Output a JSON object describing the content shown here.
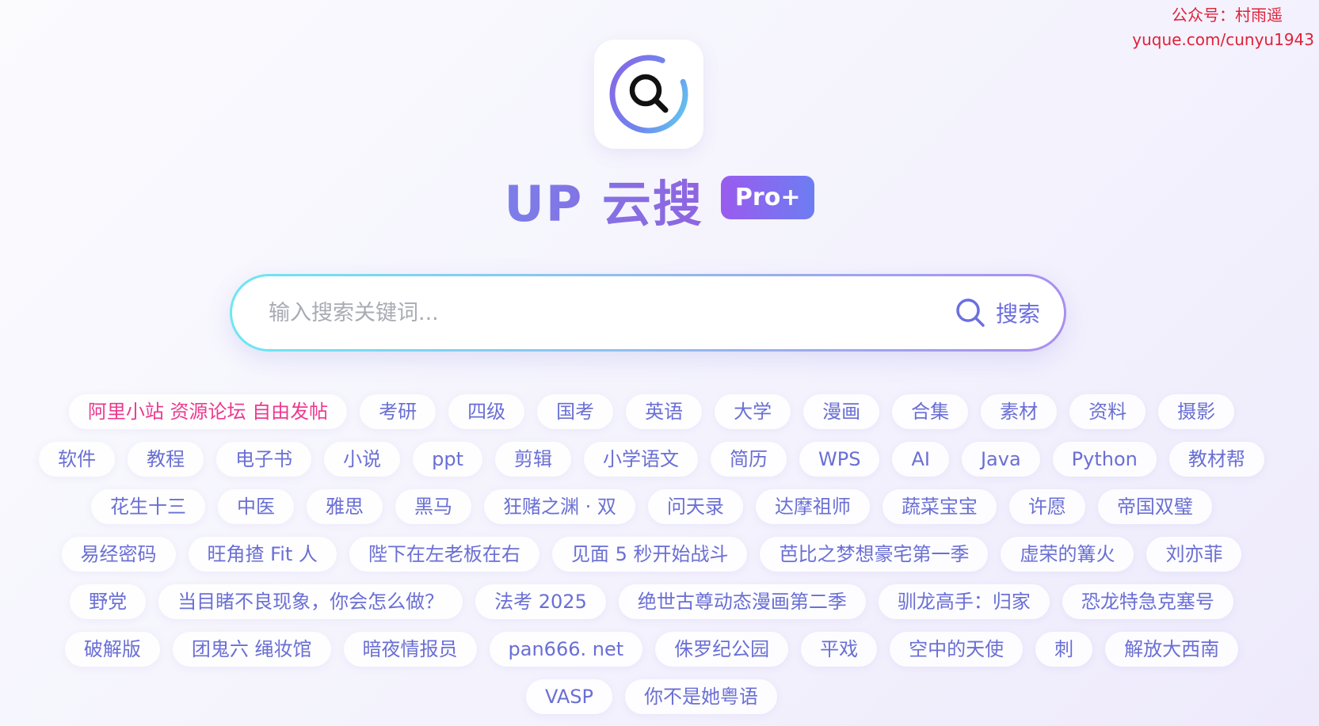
{
  "watermark": {
    "line1": "公众号：村雨遥",
    "line2": "yuque.com/cunyu1943"
  },
  "brand": {
    "title": "UP 云搜",
    "badge": "Pro+",
    "logo_icon": "search-logo-icon"
  },
  "search": {
    "placeholder": "输入搜索关键词...",
    "value": "",
    "button_label": "搜索",
    "button_icon": "search-icon"
  },
  "colors": {
    "accent": "#6c6ee0",
    "hot_tag": "#ec3a8e",
    "watermark": "#e0213a"
  },
  "tags": [
    {
      "label": "阿里小站 资源论坛 自由发帖",
      "hot": true
    },
    {
      "label": "考研"
    },
    {
      "label": "四级"
    },
    {
      "label": "国考"
    },
    {
      "label": "英语"
    },
    {
      "label": "大学"
    },
    {
      "label": "漫画"
    },
    {
      "label": "合集"
    },
    {
      "label": "素材"
    },
    {
      "label": "资料"
    },
    {
      "label": "摄影"
    },
    {
      "label": "软件"
    },
    {
      "label": "教程"
    },
    {
      "label": "电子书"
    },
    {
      "label": "小说"
    },
    {
      "label": "ppt"
    },
    {
      "label": "剪辑"
    },
    {
      "label": "小学语文"
    },
    {
      "label": "简历"
    },
    {
      "label": "WPS"
    },
    {
      "label": "AI"
    },
    {
      "label": "Java"
    },
    {
      "label": "Python"
    },
    {
      "label": "教材帮"
    },
    {
      "label": "花生十三"
    },
    {
      "label": "中医"
    },
    {
      "label": "雅思"
    },
    {
      "label": "黑马"
    },
    {
      "label": "狂赌之渊 · 双"
    },
    {
      "label": "问天录"
    },
    {
      "label": "达摩祖师"
    },
    {
      "label": "蔬菜宝宝"
    },
    {
      "label": "许愿"
    },
    {
      "label": "帝国双璧"
    },
    {
      "label": "易经密码"
    },
    {
      "label": "旺角揸 Fit 人"
    },
    {
      "label": "陛下在左老板在右"
    },
    {
      "label": "见面 5 秒开始战斗"
    },
    {
      "label": "芭比之梦想豪宅第一季"
    },
    {
      "label": "虚荣的篝火"
    },
    {
      "label": "刘亦菲"
    },
    {
      "label": "野党"
    },
    {
      "label": "当目睹不良现象，你会怎么做？"
    },
    {
      "label": "法考 2025"
    },
    {
      "label": "绝世古尊动态漫画第二季"
    },
    {
      "label": "驯龙高手：归家"
    },
    {
      "label": "恐龙特急克塞号"
    },
    {
      "label": "破解版"
    },
    {
      "label": "团鬼六 绳妆馆"
    },
    {
      "label": "暗夜情报员"
    },
    {
      "label": "pan666. net"
    },
    {
      "label": "侏罗纪公园"
    },
    {
      "label": "平戏"
    },
    {
      "label": "空中的天使"
    },
    {
      "label": "刺"
    },
    {
      "label": "解放大西南"
    },
    {
      "label": "VASP"
    },
    {
      "label": "你不是她粤语"
    }
  ]
}
